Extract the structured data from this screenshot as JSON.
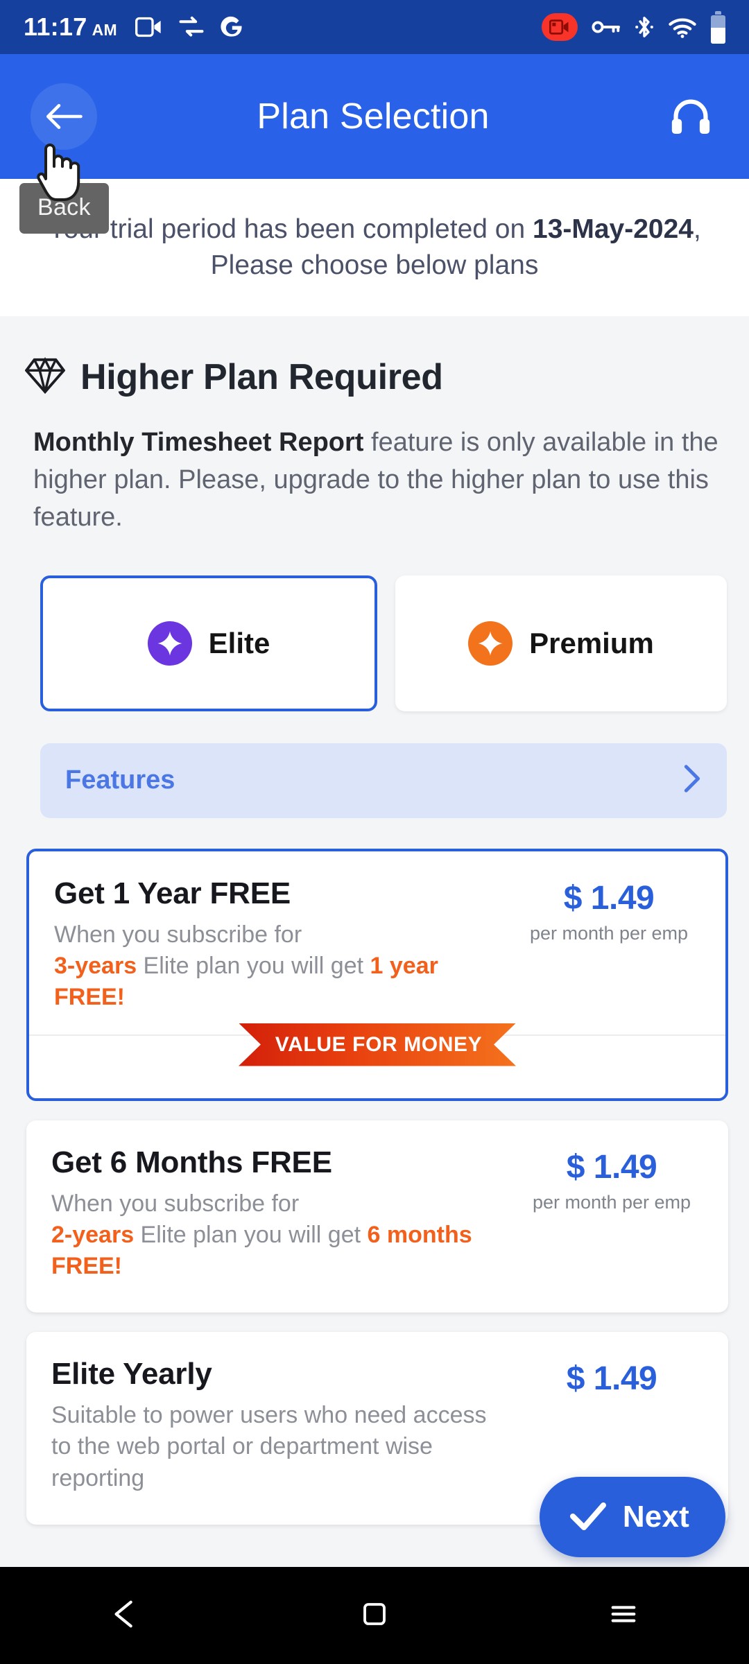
{
  "statusbar": {
    "time": "11:17",
    "ampm": "AM",
    "icons_left": [
      "video-call-icon",
      "data-saver-icon",
      "google-icon"
    ],
    "icons_right": [
      "screen-record-icon",
      "vpn-key-icon",
      "bluetooth-icon",
      "wifi-icon",
      "battery-icon"
    ],
    "bg_color": "#16409d"
  },
  "appbar": {
    "title": "Plan Selection",
    "back_icon": "back-arrow-icon",
    "support_icon": "headset-support-icon",
    "bg_color": "#2962e8"
  },
  "cursor": {
    "tooltip": "Back"
  },
  "trial_banner": {
    "text_before": "Your trial period has been completed on ",
    "date": "13-May-2024",
    "text_after": ", Please choose below plans"
  },
  "higher_plan": {
    "icon": "diamond-icon",
    "heading": "Higher Plan Required",
    "desc_bold": "Monthly Timesheet Report",
    "desc_rest": " feature is only available in the higher plan. Please, upgrade to the higher plan to use this feature."
  },
  "plan_toggle": {
    "options": [
      {
        "label": "Elite",
        "icon": "sparkle-icon",
        "color": "#6b35e0",
        "selected": true
      },
      {
        "label": "Premium",
        "icon": "sparkle-icon",
        "color": "#f2731b",
        "selected": false
      }
    ]
  },
  "features_row": {
    "label": "Features",
    "chevron": "chevron-right-icon",
    "bg_color": "#dce4fa",
    "text_color": "#4b77e4"
  },
  "plan_cards": [
    {
      "title": "Get 1 Year FREE",
      "sub_plain_1": "When you subscribe for",
      "sub_hl_1": "3-years",
      "sub_plain_2": " Elite plan you will get ",
      "sub_hl_2": "1 year FREE!",
      "price": "$ 1.49",
      "price_unit": "per month per emp",
      "ribbon": "VALUE FOR MONEY",
      "selected": true
    },
    {
      "title": "Get 6 Months FREE",
      "sub_plain_1": "When you subscribe for",
      "sub_hl_1": "2-years",
      "sub_plain_2": " Elite plan you will get ",
      "sub_hl_2": "6 months FREE!",
      "price": "$ 1.49",
      "price_unit": "per month per emp",
      "ribbon": "",
      "selected": false
    },
    {
      "title": "Elite Yearly",
      "sub_plain_1": "Suitable to power users who need access to the web portal or department wise reporting",
      "sub_hl_1": "",
      "sub_plain_2": "",
      "sub_hl_2": "",
      "price": "$ 1.49",
      "price_unit": "",
      "ribbon": "",
      "selected": false
    }
  ],
  "next_button": {
    "label": "Next",
    "icon": "check-icon",
    "color": "#2a5fdc"
  },
  "navbar": {
    "items": [
      "back-triangle-icon",
      "home-square-icon",
      "recents-menu-icon"
    ]
  }
}
